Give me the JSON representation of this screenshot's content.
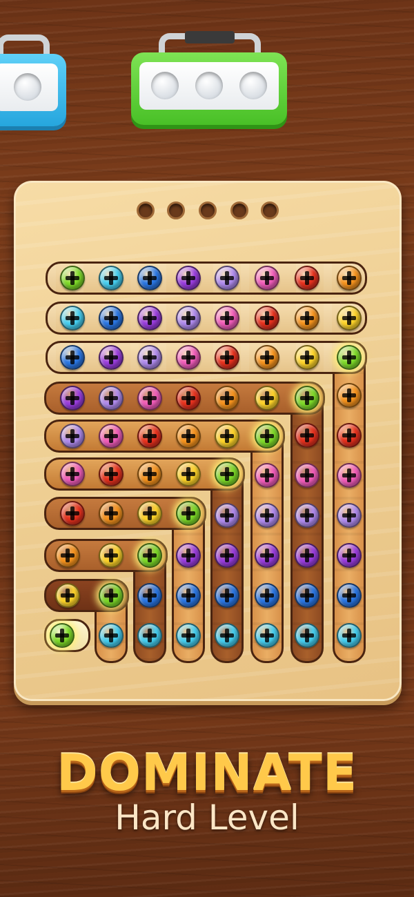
{
  "headline": "DOMINATE",
  "subline": "Hard Level",
  "toolboxes": [
    {
      "name": "blue-toolbox",
      "color": "#39b9ec",
      "slots": 1
    },
    {
      "name": "green-toolbox",
      "color": "#5bd13b",
      "slots": 3
    }
  ],
  "board": {
    "holes": 5,
    "colors": {
      "green": "#7fdc2a",
      "cyan": "#46d0f2",
      "blue": "#2b78e6",
      "purple": "#9b3ee0",
      "lavender": "#b18cf0",
      "pink": "#f25dbb",
      "red": "#e8321f",
      "orange": "#f7941e",
      "yellow": "#ffd52a"
    },
    "rows": [
      [
        "green",
        "cyan",
        "blue",
        "purple",
        "lavender",
        "pink",
        "red",
        "orange"
      ],
      [
        "cyan",
        "blue",
        "purple",
        "lavender",
        "pink",
        "red",
        "orange",
        "yellow"
      ],
      [
        "blue",
        "purple",
        "lavender",
        "pink",
        "red",
        "orange",
        "yellow",
        "green"
      ],
      [
        "purple",
        "lavender",
        "pink",
        "red",
        "orange",
        "yellow",
        "green"
      ],
      [
        "lavender",
        "pink",
        "red",
        "orange",
        "yellow",
        "green"
      ],
      [
        "pink",
        "red",
        "orange",
        "yellow",
        "green"
      ],
      [
        "red",
        "orange",
        "yellow",
        "green"
      ],
      [
        "orange",
        "yellow",
        "green"
      ],
      [
        "yellow",
        "green"
      ],
      [
        "green"
      ]
    ],
    "columns": [
      [
        "cyan"
      ],
      [
        "cyan",
        "blue"
      ],
      [
        "cyan",
        "blue",
        "purple"
      ],
      [
        "cyan",
        "blue",
        "purple",
        "lavender"
      ],
      [
        "cyan",
        "blue",
        "purple",
        "lavender",
        "pink"
      ],
      [
        "cyan",
        "blue",
        "purple",
        "lavender",
        "pink",
        "red"
      ],
      [
        "cyan",
        "blue",
        "purple",
        "lavender",
        "pink",
        "red",
        "orange"
      ]
    ]
  }
}
